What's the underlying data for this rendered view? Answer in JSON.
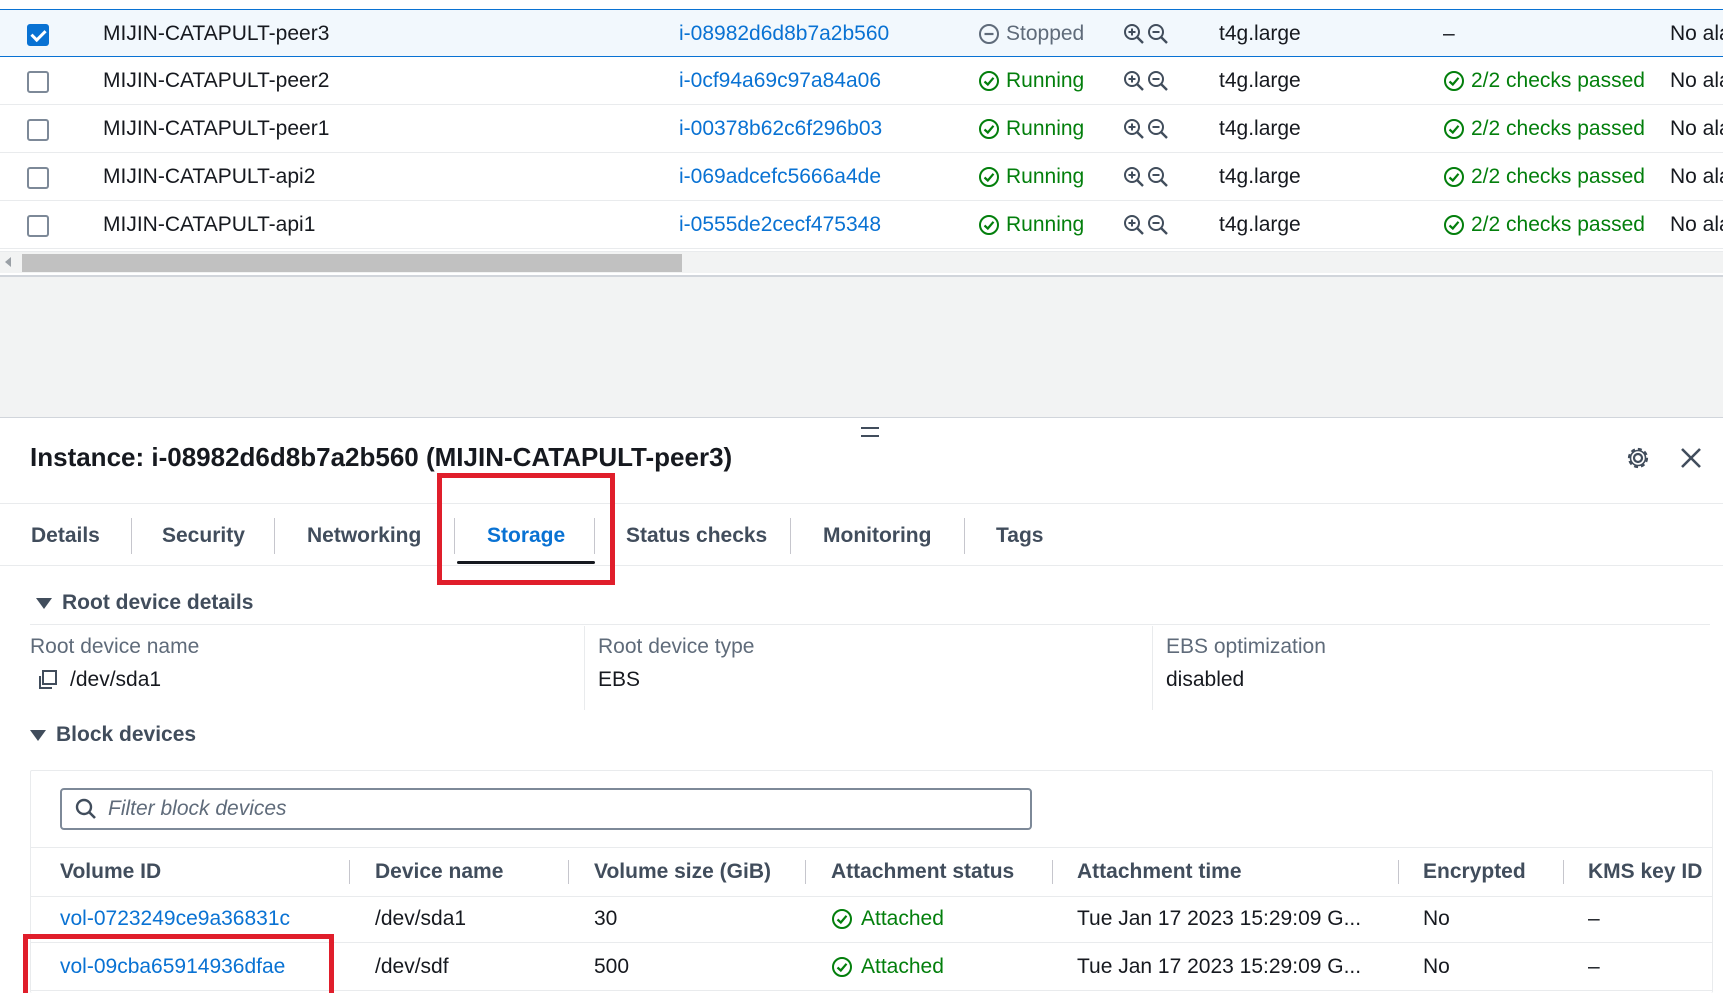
{
  "instances": {
    "rows": [
      {
        "selected": true,
        "name": "MIJIN-CATAPULT-peer3",
        "id": "i-08982d6d8b7a2b560",
        "state": "Stopped",
        "state_kind": "stopped",
        "type": "t4g.large",
        "checks": "–",
        "checks_kind": "dash",
        "alarm": "No ala"
      },
      {
        "selected": false,
        "name": "MIJIN-CATAPULT-peer2",
        "id": "i-0cf94a69c97a84a06",
        "state": "Running",
        "state_kind": "running",
        "type": "t4g.large",
        "checks": "2/2 checks passed",
        "checks_kind": "ok",
        "alarm": "No ala"
      },
      {
        "selected": false,
        "name": "MIJIN-CATAPULT-peer1",
        "id": "i-00378b62c6f296b03",
        "state": "Running",
        "state_kind": "running",
        "type": "t4g.large",
        "checks": "2/2 checks passed",
        "checks_kind": "ok",
        "alarm": "No ala"
      },
      {
        "selected": false,
        "name": "MIJIN-CATAPULT-api2",
        "id": "i-069adcefc5666a4de",
        "state": "Running",
        "state_kind": "running",
        "type": "t4g.large",
        "checks": "2/2 checks passed",
        "checks_kind": "ok",
        "alarm": "No ala"
      },
      {
        "selected": false,
        "name": "MIJIN-CATAPULT-api1",
        "id": "i-0555de2cecf475348",
        "state": "Running",
        "state_kind": "running",
        "type": "t4g.large",
        "checks": "2/2 checks passed",
        "checks_kind": "ok",
        "alarm": "No ala"
      }
    ]
  },
  "panel": {
    "title": "Instance: i-08982d6d8b7a2b560 (MIJIN-CATAPULT-peer3)",
    "tabs": [
      {
        "label": "Details"
      },
      {
        "label": "Security"
      },
      {
        "label": "Networking"
      },
      {
        "label": "Storage"
      },
      {
        "label": "Status checks"
      },
      {
        "label": "Monitoring"
      },
      {
        "label": "Tags"
      }
    ],
    "active_tab": "Storage"
  },
  "root_device": {
    "heading": "Root device details",
    "name_label": "Root device name",
    "name_value": "/dev/sda1",
    "type_label": "Root device type",
    "type_value": "EBS",
    "ebs_label": "EBS optimization",
    "ebs_value": "disabled"
  },
  "block_devices": {
    "heading": "Block devices",
    "filter_placeholder": "Filter block devices",
    "columns": [
      "Volume ID",
      "Device name",
      "Volume size (GiB)",
      "Attachment status",
      "Attachment time",
      "Encrypted",
      "KMS key ID"
    ],
    "rows": [
      {
        "volume_id": "vol-0723249ce9a36831c",
        "device": "/dev/sda1",
        "size": "30",
        "status": "Attached",
        "time": "Tue Jan 17 2023 15:29:09 G...",
        "encrypted": "No",
        "kms": "–"
      },
      {
        "volume_id": "vol-09cba65914936dfae",
        "device": "/dev/sdf",
        "size": "500",
        "status": "Attached",
        "time": "Tue Jan 17 2023 15:29:09 G...",
        "encrypted": "No",
        "kms": "–"
      }
    ]
  },
  "colors": {
    "link": "#0972d3",
    "success": "#037f0c",
    "highlight": "#e01e2b"
  },
  "icons": {
    "running": "check-circle-icon",
    "stopped": "stopped-circle-icon",
    "zoom": "zoom-in-out-icon",
    "settings": "gear-icon",
    "close": "close-icon",
    "copy": "copy-icon",
    "search": "search-icon"
  }
}
